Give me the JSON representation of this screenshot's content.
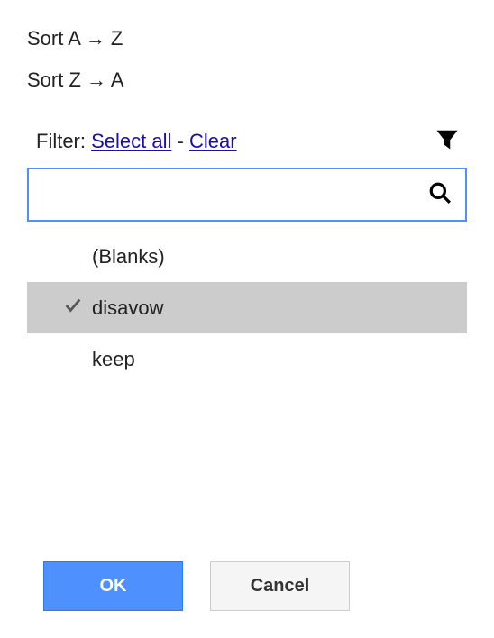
{
  "sort": {
    "asc_label": "Sort A → Z",
    "desc_label": "Sort Z → A"
  },
  "filter": {
    "label": "Filter:",
    "select_all": "Select all",
    "separator": "-",
    "clear": "Clear",
    "search_placeholder": ""
  },
  "items": [
    {
      "label": "(Blanks)",
      "checked": false,
      "highlighted": false
    },
    {
      "label": "disavow",
      "checked": true,
      "highlighted": true
    },
    {
      "label": "keep",
      "checked": false,
      "highlighted": false
    }
  ],
  "buttons": {
    "ok": "OK",
    "cancel": "Cancel"
  }
}
